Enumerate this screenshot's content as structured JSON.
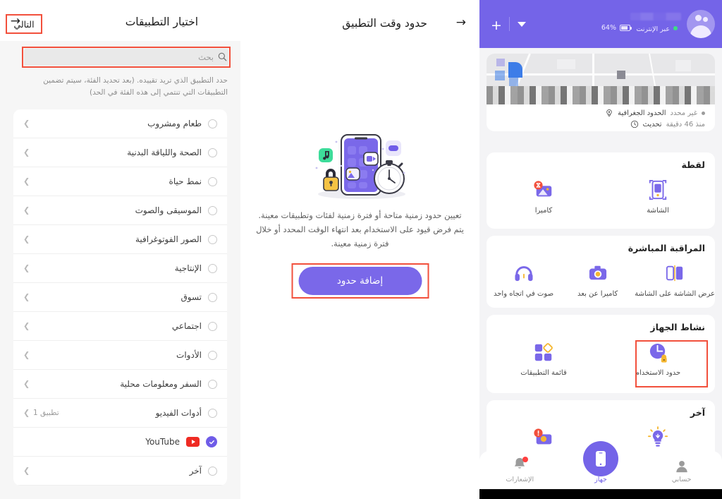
{
  "panel_apps": {
    "title": "اختيار التطبيقات",
    "back_icon": "arrow-right-icon",
    "next_label": "التالي",
    "search": {
      "placeholder": "بحث",
      "value": "",
      "icon": "search-icon"
    },
    "hint": "حدد التطبيق الذي تريد تقييده. (بعد تحديد الفئة، سيتم تضمين التطبيقات التي تنتمي إلى هذه الفئة في الحد)",
    "categories": [
      {
        "label": "طعام ومشروب",
        "count": "",
        "selected": false
      },
      {
        "label": "الصحة واللياقة البدنية",
        "count": "",
        "selected": false
      },
      {
        "label": "نمط حياة",
        "count": "",
        "selected": false
      },
      {
        "label": "الموسيقى والصوت",
        "count": "",
        "selected": false
      },
      {
        "label": "الصور الفوتوغرافية",
        "count": "",
        "selected": false
      },
      {
        "label": "الإنتاجية",
        "count": "",
        "selected": false
      },
      {
        "label": "تسوق",
        "count": "",
        "selected": false
      },
      {
        "label": "اجتماعي",
        "count": "",
        "selected": false
      },
      {
        "label": "الأدوات",
        "count": "",
        "selected": false
      },
      {
        "label": "السفر ومعلومات محلية",
        "count": "",
        "selected": false
      },
      {
        "label": "أدوات الفيديو",
        "count": "تطبيق 1",
        "selected": false
      }
    ],
    "sub_app": {
      "label": "YouTube",
      "icon": "youtube-icon",
      "checked": true
    },
    "last_category": {
      "label": "آخر",
      "count": "",
      "selected": false
    }
  },
  "panel_limits": {
    "title": "حدود وقت التطبيق",
    "back_icon": "arrow-right-icon",
    "illustration": "phone-time-limit-illustration",
    "description": "تعيين حدود زمنية متاحة أو فترة زمنية لفئات وتطبيقات معينة. يتم فرض قيود على الاستخدام بعد انتهاء الوقت المحدد أو خلال فترة زمنية معينة.",
    "add_button_label": "إضافة حدود"
  },
  "panel_device": {
    "topbar": {
      "add_icon": "plus-icon",
      "dropdown_icon": "chevron-down-icon",
      "avatar_icon": "avatar-icon",
      "device_name": "",
      "status": "عبر الإنترنت",
      "battery": "64%",
      "battery_icon": "battery-icon"
    },
    "map_card": {
      "geofence_label": "الحدود الجغرافية",
      "geofence_value": "غير محدد",
      "geofence_icon": "location-pin-icon",
      "update_label": "تحديث",
      "update_value": "منذ 46 دقيقة",
      "update_icon": "clock-icon"
    },
    "capture_card": {
      "title": "لقطة",
      "tiles": [
        {
          "label": "الشاشة",
          "icon": "screenshot-icon"
        },
        {
          "label": "كاميرا",
          "icon": "camera-photo-icon"
        }
      ]
    },
    "live_card": {
      "title": "المراقبة المباشرة",
      "tiles": [
        {
          "label": "عرض الشاشة على الشاشة",
          "icon": "screen-mirror-icon"
        },
        {
          "label": "كاميرا عن بعد",
          "icon": "remote-camera-icon"
        },
        {
          "label": "صوت في اتجاه واحد",
          "icon": "headphones-icon"
        }
      ]
    },
    "activity_card": {
      "title": "نشاط الجهاز",
      "tiles": [
        {
          "label": "حدود الاستخدام",
          "icon": "usage-limits-icon",
          "highlighted": true
        },
        {
          "label": "قائمة التطبيقات",
          "icon": "app-list-icon",
          "highlighted": false
        }
      ]
    },
    "other_card": {
      "title": "آخر",
      "tiles": [
        {
          "label": "",
          "icon": "lightbulb-icon"
        },
        {
          "label": "",
          "icon": "alert-photo-icon"
        }
      ]
    },
    "bottom_nav": [
      {
        "label": "حسابي",
        "icon": "person-icon",
        "active": false
      },
      {
        "label": "جهاز",
        "icon": "phone-icon",
        "active": true
      },
      {
        "label": "الإشعارات",
        "icon": "bell-icon",
        "active": false,
        "badge": true
      }
    ]
  },
  "annotations": {
    "accent_red": "#f2503c",
    "brand_purple": "#7464e8"
  }
}
